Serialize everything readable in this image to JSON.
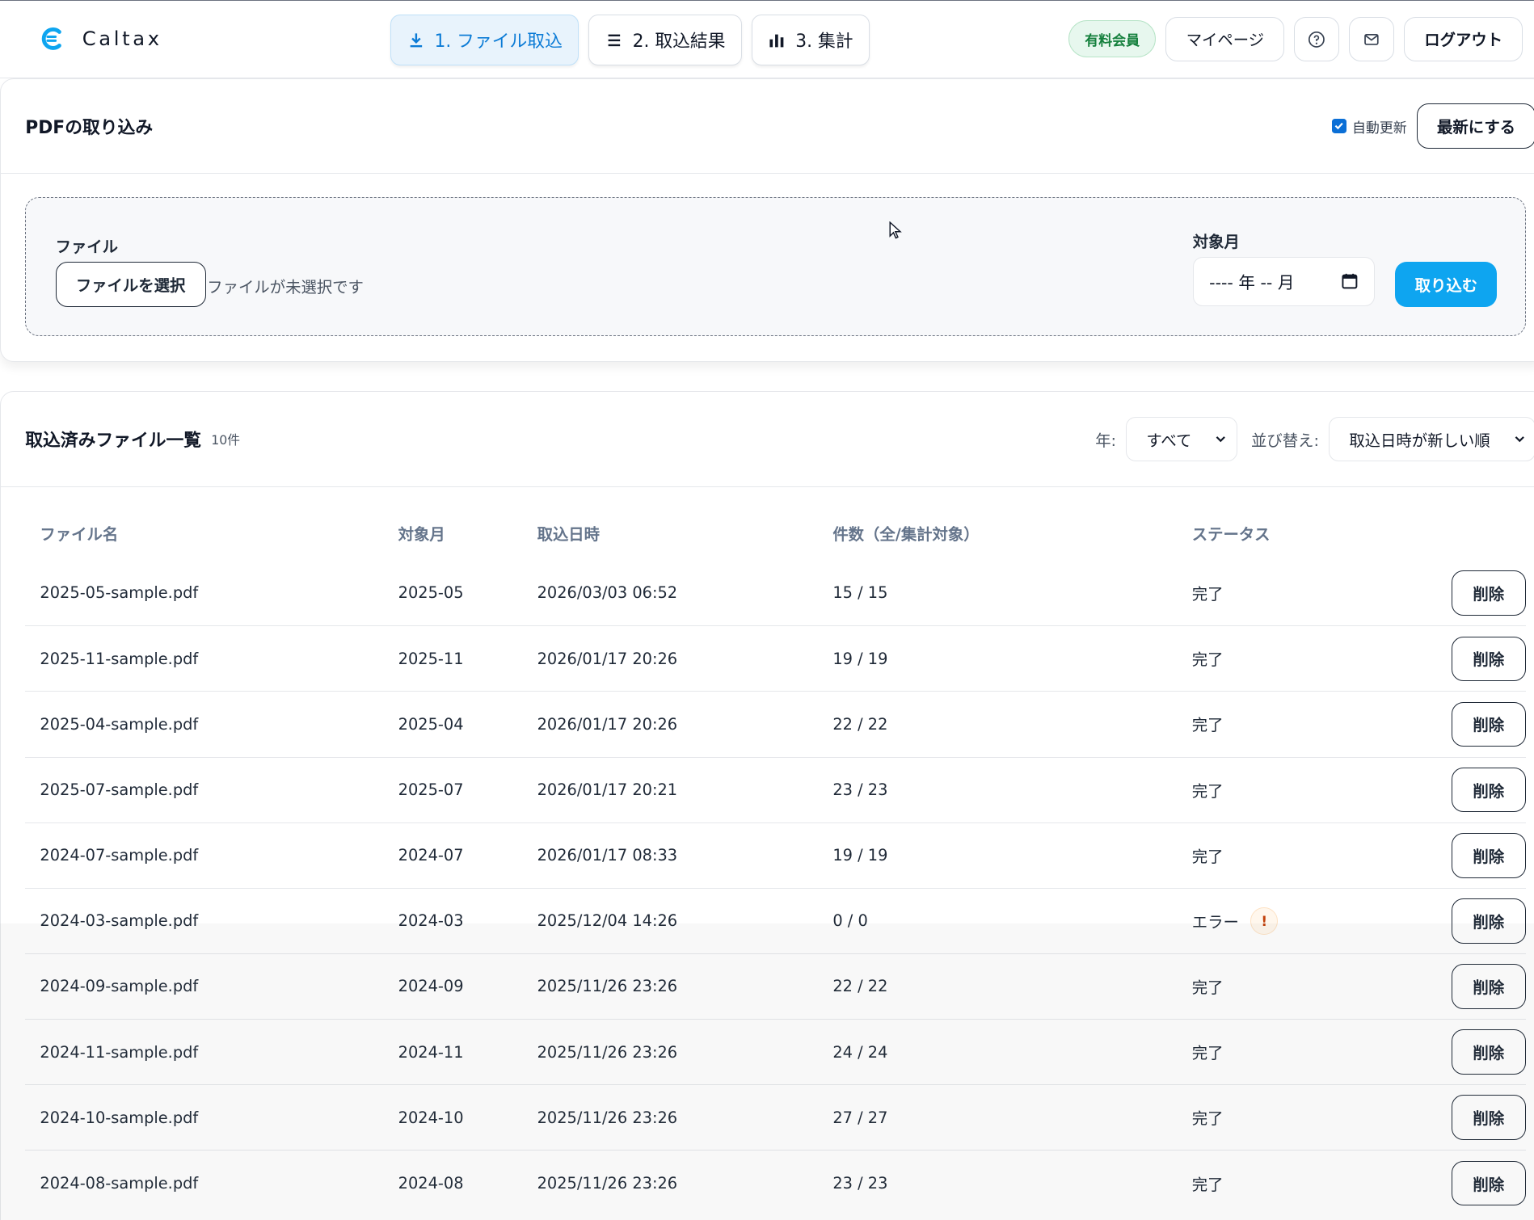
{
  "brand": {
    "name": "Caltax"
  },
  "tabs": [
    {
      "label": "1. ファイル取込",
      "icon": "download-icon",
      "active": true
    },
    {
      "label": "2. 取込結果",
      "icon": "list-icon",
      "active": false
    },
    {
      "label": "3. 集計",
      "icon": "bar-chart-icon",
      "active": false
    }
  ],
  "header": {
    "member_badge": "有料会員",
    "mypage": "マイページ",
    "logout": "ログアウト",
    "icons": [
      "help-icon",
      "mail-icon"
    ]
  },
  "import": {
    "title": "PDFの取り込み",
    "auto_refresh_label": "自動更新",
    "auto_refresh_checked": true,
    "refresh_button": "最新にする",
    "file_label": "ファイル",
    "file_button": "ファイルを選択",
    "file_status": "ファイルが未選択です",
    "month_label": "対象月",
    "month_placeholder": "---- 年 -- 月",
    "import_button": "取り込む"
  },
  "list": {
    "title": "取込済みファイル一覧",
    "count": "10件",
    "year_label": "年:",
    "year_value": "すべて",
    "sort_label": "並び替え:",
    "sort_value": "取込日時が新しい順",
    "columns": [
      "ファイル名",
      "対象月",
      "取込日時",
      "件数（全/集計対象）",
      "ステータス"
    ],
    "delete_label": "削除",
    "rows": [
      {
        "file": "2025-05-sample.pdf",
        "month": "2025-05",
        "date": "2026/03/03 06:52",
        "count": "15 / 15",
        "status": "完了"
      },
      {
        "file": "2025-11-sample.pdf",
        "month": "2025-11",
        "date": "2026/01/17 20:26",
        "count": "19 / 19",
        "status": "完了"
      },
      {
        "file": "2025-04-sample.pdf",
        "month": "2025-04",
        "date": "2026/01/17 20:26",
        "count": "22 / 22",
        "status": "完了"
      },
      {
        "file": "2025-07-sample.pdf",
        "month": "2025-07",
        "date": "2026/01/17 20:21",
        "count": "23 / 23",
        "status": "完了"
      },
      {
        "file": "2024-07-sample.pdf",
        "month": "2024-07",
        "date": "2026/01/17 08:33",
        "count": "19 / 19",
        "status": "完了"
      },
      {
        "file": "2024-03-sample.pdf",
        "month": "2024-03",
        "date": "2025/12/04 14:26",
        "count": "0 / 0",
        "status": "エラー",
        "error_mark": "!"
      },
      {
        "file": "2024-09-sample.pdf",
        "month": "2024-09",
        "date": "2025/11/26 23:26",
        "count": "22 / 22",
        "status": "完了"
      },
      {
        "file": "2024-11-sample.pdf",
        "month": "2024-11",
        "date": "2025/11/26 23:26",
        "count": "24 / 24",
        "status": "完了"
      },
      {
        "file": "2024-10-sample.pdf",
        "month": "2024-10",
        "date": "2025/11/26 23:26",
        "count": "27 / 27",
        "status": "完了"
      },
      {
        "file": "2024-08-sample.pdf",
        "month": "2024-08",
        "date": "2025/11/26 23:26",
        "count": "23 / 23",
        "status": "完了"
      }
    ]
  },
  "colors": {
    "accent": "#0ea5f0",
    "active_tab": "#0b7bd6",
    "member_green": "#15803d",
    "error": "#c2410c"
  }
}
